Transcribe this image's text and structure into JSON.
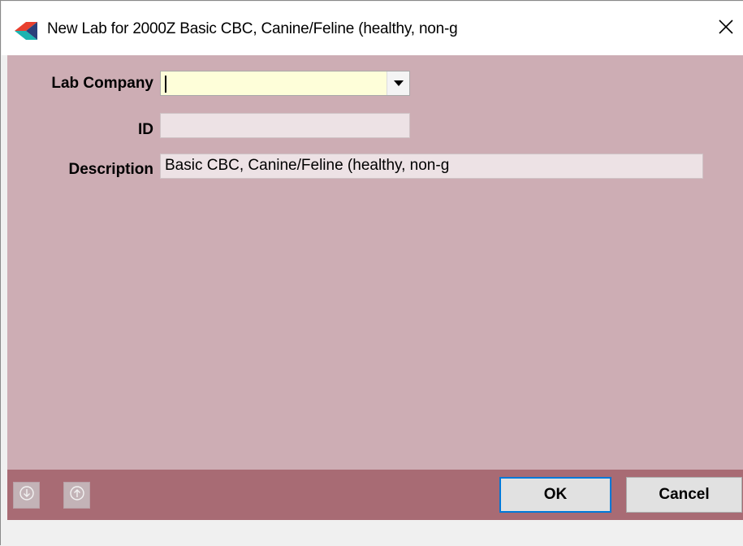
{
  "window": {
    "title": "New Lab for 2000Z Basic CBC, Canine/Feline (healthy, non-g",
    "close_glyph": "✕",
    "icon": "app-logo-icon"
  },
  "form": {
    "lab_company": {
      "label": "Lab Company",
      "value": ""
    },
    "id": {
      "label": "ID",
      "value": ""
    },
    "description": {
      "label": "Description",
      "value": "Basic CBC, Canine/Feline (healthy, non-g"
    }
  },
  "footer": {
    "nav_down_icon": "arrow-down-circle-icon",
    "nav_up_icon": "arrow-up-circle-icon",
    "ok_label": "OK",
    "cancel_label": "Cancel"
  },
  "colors": {
    "form_background": "#cdadb4",
    "footer_background": "#a86b74",
    "combo_background": "#fefed9",
    "default_button_border": "#0078d7"
  }
}
